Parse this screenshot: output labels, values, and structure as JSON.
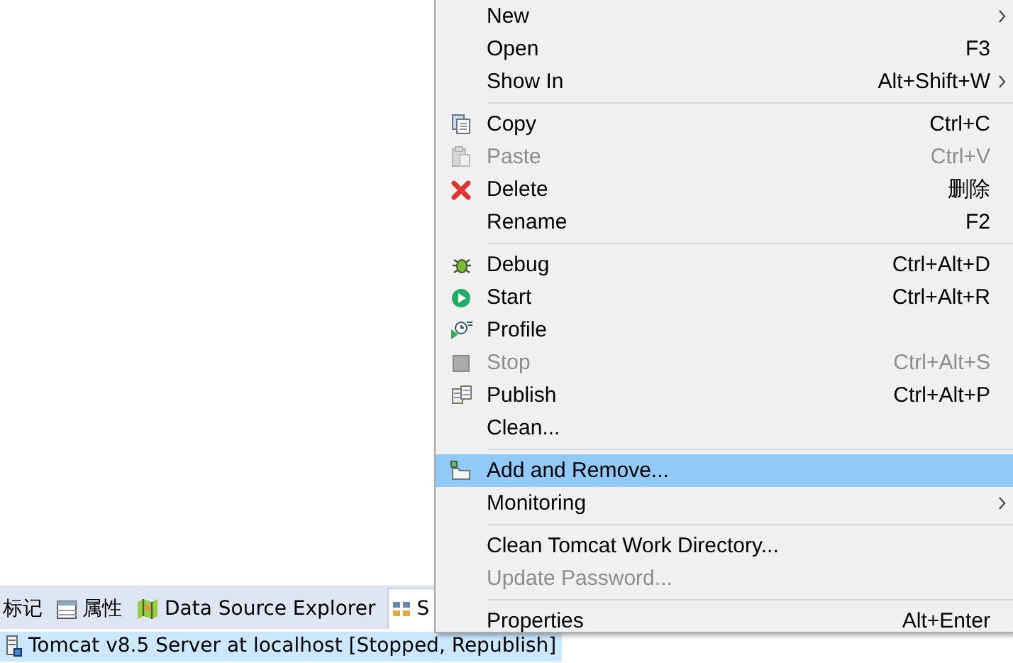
{
  "tabs": [
    {
      "label": "标记",
      "selected": false
    },
    {
      "label": "属性",
      "selected": false
    },
    {
      "label": "Data Source Explorer",
      "selected": false
    },
    {
      "label": "S",
      "selected": true
    }
  ],
  "servers": [
    {
      "label": "Tomcat v8.5 Server at localhost  [Stopped, Republish]",
      "selected": true
    }
  ],
  "context_menu": {
    "groups": [
      [
        {
          "label": "New",
          "submenu": true,
          "disabled": false,
          "selected": false
        },
        {
          "label": "Open",
          "shortcut": "F3",
          "disabled": false,
          "selected": false
        },
        {
          "label": "Show In",
          "shortcut": "Alt+Shift+W",
          "submenu": true,
          "disabled": false,
          "selected": false
        }
      ],
      [
        {
          "label": "Copy",
          "shortcut": "Ctrl+C",
          "disabled": false,
          "selected": false
        },
        {
          "label": "Paste",
          "shortcut": "Ctrl+V",
          "disabled": true,
          "selected": false
        },
        {
          "label": "Delete",
          "shortcut": "删除",
          "disabled": false,
          "selected": false
        },
        {
          "label": "Rename",
          "shortcut": "F2",
          "disabled": false,
          "selected": false
        }
      ],
      [
        {
          "label": "Debug",
          "shortcut": "Ctrl+Alt+D",
          "disabled": false,
          "selected": false
        },
        {
          "label": "Start",
          "shortcut": "Ctrl+Alt+R",
          "disabled": false,
          "selected": false
        },
        {
          "label": "Profile",
          "disabled": false,
          "selected": false
        },
        {
          "label": "Stop",
          "shortcut": "Ctrl+Alt+S",
          "disabled": true,
          "selected": false
        },
        {
          "label": "Publish",
          "shortcut": "Ctrl+Alt+P",
          "disabled": false,
          "selected": false
        },
        {
          "label": "Clean...",
          "disabled": false,
          "selected": false
        }
      ],
      [
        {
          "label": "Add and Remove...",
          "disabled": false,
          "selected": true
        },
        {
          "label": "Monitoring",
          "submenu": true,
          "disabled": false,
          "selected": false
        }
      ],
      [
        {
          "label": "Clean Tomcat Work Directory...",
          "disabled": false,
          "selected": false
        },
        {
          "label": "Update Password...",
          "disabled": true,
          "selected": false
        }
      ],
      [
        {
          "label": "Properties",
          "shortcut": "Alt+Enter",
          "disabled": false,
          "selected": false
        }
      ]
    ]
  }
}
